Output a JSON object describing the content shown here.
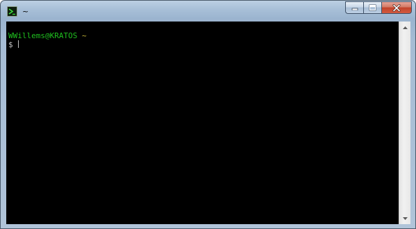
{
  "window": {
    "title": "~",
    "icon": "terminal-icon"
  },
  "caption_buttons": {
    "minimize_icon": "minimize-icon",
    "maximize_icon": "maximize-icon",
    "close_icon": "close-icon",
    "close_color": "#c2432a"
  },
  "terminal": {
    "background": "#000000",
    "user_host": "WWillems@KRATOS",
    "cwd": "~",
    "prompt_symbol": "$",
    "user_host_color": "#1fbf1f",
    "cwd_color": "#c8b83a"
  },
  "scrollbar": {
    "up_icon": "scroll-up-arrow-icon",
    "down_icon": "scroll-down-arrow-icon"
  }
}
